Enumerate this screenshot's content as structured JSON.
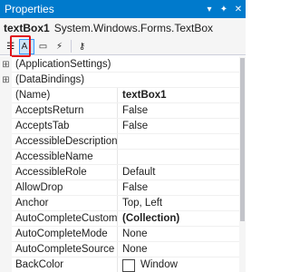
{
  "window": {
    "title": "Properties",
    "dropdown_icon": "chevron-down-icon",
    "pin_icon": "pin-icon",
    "close_icon": "close-icon"
  },
  "object": {
    "name": "textBox1",
    "type": "System.Windows.Forms.TextBox"
  },
  "toolbar": {
    "items": [
      {
        "icon": "categorized-icon",
        "glyph": "☷",
        "active": false
      },
      {
        "icon": "alphabetical-sort-icon",
        "glyph": "A↓",
        "active": true
      },
      {
        "icon": "properties-icon",
        "glyph": "▭",
        "active": false
      },
      {
        "icon": "events-lightning-icon",
        "glyph": "⚡",
        "active": false
      },
      {
        "icon": "property-pages-icon",
        "glyph": "⚷",
        "active": false
      }
    ]
  },
  "colors": {
    "titlebar": "#007acc",
    "highlight": "#e0131a",
    "selected_tool": "#cce4f7"
  },
  "properties": [
    {
      "name": "(ApplicationSettings)",
      "value": "",
      "expander": "⊞",
      "category": true
    },
    {
      "name": "(DataBindings)",
      "value": "",
      "expander": "⊞",
      "category": true
    },
    {
      "name": "(Name)",
      "value": "textBox1",
      "bold": true
    },
    {
      "name": "AcceptsReturn",
      "value": "False"
    },
    {
      "name": "AcceptsTab",
      "value": "False"
    },
    {
      "name": "AccessibleDescription",
      "value": ""
    },
    {
      "name": "AccessibleName",
      "value": ""
    },
    {
      "name": "AccessibleRole",
      "value": "Default"
    },
    {
      "name": "AllowDrop",
      "value": "False"
    },
    {
      "name": "Anchor",
      "value": "Top, Left"
    },
    {
      "name": "AutoCompleteCustomS",
      "value": "(Collection)",
      "bold": true
    },
    {
      "name": "AutoCompleteMode",
      "value": "None"
    },
    {
      "name": "AutoCompleteSource",
      "value": "None"
    },
    {
      "name": "BackColor",
      "value": "Window",
      "swatch": "#ffffff"
    }
  ]
}
